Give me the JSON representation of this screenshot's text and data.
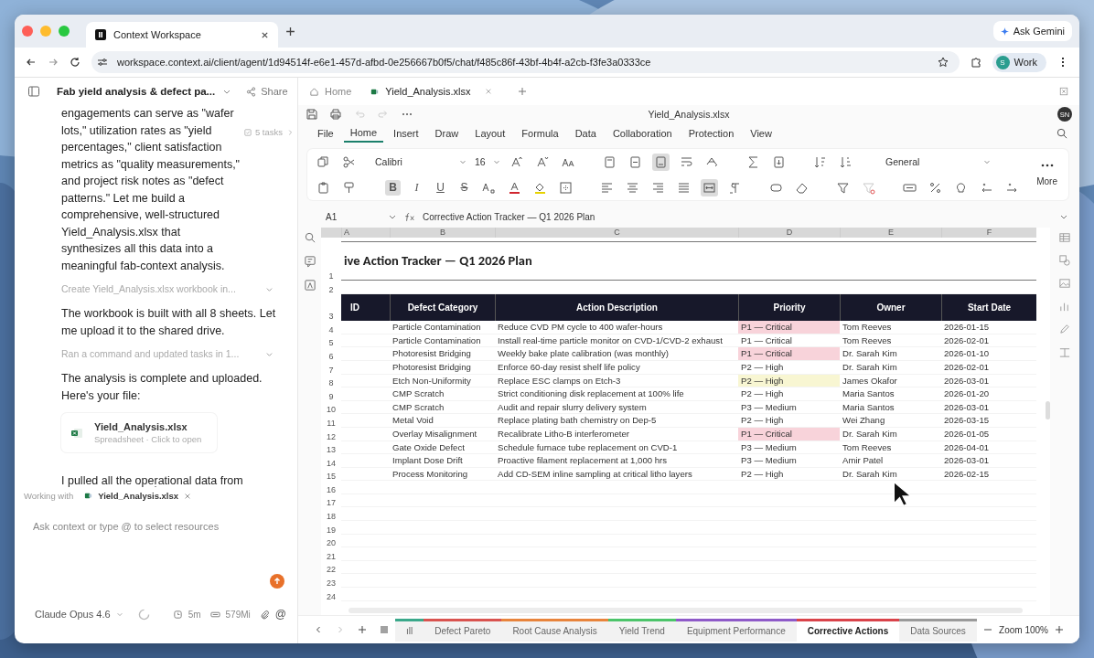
{
  "browser": {
    "tab": {
      "title": "Context Workspace",
      "selected": true
    },
    "ask_button": "Ask Gemini",
    "url": "workspace.context.ai/client/agent/1d94514f-e6e1-457d-afbd-0e256667b0f5/chat/f485c86f-43bf-4b4f-a2cb-f3fe3a0333ce",
    "profile": {
      "initial": "S",
      "label": "Work"
    }
  },
  "chat": {
    "title": "Fab yield analysis & defect pa...",
    "share": "Share",
    "tasks_chip": "5 tasks",
    "messages": [
      {
        "kind": "text",
        "text": "engagements can serve as \"wafer lots,\" utilization rates as \"yield percentages,\" client satisfaction metrics as \"quality measurements,\" and project risk notes as \"defect patterns.\" Let me build a comprehensive, well-structured Yield_Analysis.xlsx that synthesizes all this data into a meaningful fab-context analysis."
      },
      {
        "kind": "step",
        "text": "Create Yield_Analysis.xlsx workbook in..."
      },
      {
        "kind": "text",
        "text": "The workbook is built with all 8 sheets. Let me upload it to the shared drive."
      },
      {
        "kind": "step",
        "text": "Ran a command and updated tasks in 1..."
      },
      {
        "kind": "text",
        "text": "The analysis is complete and uploaded. Here's your file:"
      },
      {
        "kind": "file",
        "name": "Yield_Analysis.xlsx",
        "meta": "Spreadsheet · Click to open"
      },
      {
        "kind": "text",
        "text": "I pulled all the operational data from"
      }
    ],
    "working_with": {
      "label": "Working with",
      "file": "Yield_Analysis.xlsx"
    },
    "input": {
      "placeholder": "Ask context or type @ to select resources"
    },
    "model": "Claude Opus 4.6",
    "time": "5m",
    "memory": "579Mi",
    "mention": "@"
  },
  "workbook": {
    "tabs": [
      {
        "label": "Home",
        "selected": false
      },
      {
        "label": "Yield_Analysis.xlsx",
        "selected": true
      }
    ],
    "title": "Yield_Analysis.xlsx",
    "user_initials": "SN",
    "menu": [
      {
        "label": "File",
        "selected": false
      },
      {
        "label": "Home",
        "selected": true
      },
      {
        "label": "Insert",
        "selected": false
      },
      {
        "label": "Draw",
        "selected": false
      },
      {
        "label": "Layout",
        "selected": false
      },
      {
        "label": "Formula",
        "selected": false
      },
      {
        "label": "Data",
        "selected": false
      },
      {
        "label": "Collaboration",
        "selected": false
      },
      {
        "label": "Protection",
        "selected": false
      },
      {
        "label": "View",
        "selected": false
      }
    ],
    "font": "Calibri",
    "font_size": "16",
    "number_format": "General",
    "more": "More",
    "format_buttons": [
      {
        "label": "B",
        "selected": true
      },
      {
        "label": "I",
        "selected": false
      },
      {
        "label": "U",
        "selected": false
      },
      {
        "label": "S",
        "selected": false
      }
    ],
    "cell_ref": "A1",
    "formula": "Corrective Action Tracker — Q1 2026 Plan",
    "columns": [
      "A",
      "B",
      "C",
      "D",
      "E",
      "F"
    ],
    "sheet_title": "ive Action Tracker — Q1 2026 Plan",
    "header_row": "3",
    "headers": [
      "ID",
      "Defect Category",
      "Action Description",
      "Priority",
      "Owner",
      "Start Date"
    ],
    "rows": [
      {
        "row": "4",
        "category": "Particle Contamination",
        "action": "Reduce CVD PM cycle to 400 wafer-hours",
        "priority": "P1 — Critical",
        "owner": "Tom Reeves",
        "start": "2026-01-15",
        "color": "#f8d3da"
      },
      {
        "row": "5",
        "category": "Particle Contamination",
        "action": "Install real-time particle monitor on CVD-1/CVD-2 exhaust",
        "priority": "P1 — Critical",
        "owner": "Tom Reeves",
        "start": "2026-02-01"
      },
      {
        "row": "6",
        "category": "Photoresist Bridging",
        "action": "Weekly bake plate calibration (was monthly)",
        "priority": "P1 — Critical",
        "owner": "Dr. Sarah Kim",
        "start": "2026-01-10",
        "color": "#f8d3da"
      },
      {
        "row": "7",
        "category": "Photoresist Bridging",
        "action": "Enforce 60-day resist shelf life policy",
        "priority": "P2 — High",
        "owner": "Dr. Sarah Kim",
        "start": "2026-02-01"
      },
      {
        "row": "8",
        "category": "Etch Non-Uniformity",
        "action": "Replace ESC clamps on Etch-3",
        "priority": "P2 — High",
        "owner": "James Okafor",
        "start": "2026-03-01",
        "color": "#f8f6d2"
      },
      {
        "row": "9",
        "category": "CMP Scratch",
        "action": "Strict conditioning disk replacement at 100% life",
        "priority": "P2 — High",
        "owner": "Maria Santos",
        "start": "2026-01-20"
      },
      {
        "row": "10",
        "category": "CMP Scratch",
        "action": "Audit and repair slurry delivery system",
        "priority": "P3 — Medium",
        "owner": "Maria Santos",
        "start": "2026-03-01"
      },
      {
        "row": "11",
        "category": "Metal Void",
        "action": "Replace plating bath chemistry on Dep-5",
        "priority": "P2 — High",
        "owner": "Wei Zhang",
        "start": "2026-03-15"
      },
      {
        "row": "12",
        "category": "Overlay Misalignment",
        "action": "Recalibrate Litho-B interferometer",
        "priority": "P1 — Critical",
        "owner": "Dr. Sarah Kim",
        "start": "2026-01-05",
        "color": "#f8d3da"
      },
      {
        "row": "13",
        "category": "Gate Oxide Defect",
        "action": "Schedule furnace tube replacement on CVD-1",
        "priority": "P3 — Medium",
        "owner": "Tom Reeves",
        "start": "2026-04-01"
      },
      {
        "row": "14",
        "category": "Implant Dose Drift",
        "action": "Proactive filament replacement at 1,000 hrs",
        "priority": "P3 — Medium",
        "owner": "Amir Patel",
        "start": "2026-03-01"
      },
      {
        "row": "15",
        "category": "Process Monitoring",
        "action": "Add CD-SEM inline sampling at critical litho layers",
        "priority": "P2 — High",
        "owner": "Dr. Sarah Kim",
        "start": "2026-02-15"
      }
    ],
    "top_rows": [
      "1",
      "2"
    ],
    "empty_rows": [
      "16",
      "17",
      "18",
      "19",
      "20",
      "21",
      "22",
      "23",
      "24"
    ],
    "sheets": [
      {
        "label": "ıll",
        "color": "#3aa88a",
        "selected": false
      },
      {
        "label": "Defect Pareto",
        "color": "#d9534f",
        "selected": false
      },
      {
        "label": "Root Cause Analysis",
        "color": "#e8843c",
        "selected": false
      },
      {
        "label": "Yield Trend",
        "color": "#4cc46a",
        "selected": false
      },
      {
        "label": "Equipment Performance",
        "color": "#8e5ac8",
        "selected": false
      },
      {
        "label": "Corrective Actions",
        "color": "#d9434a",
        "selected": true
      },
      {
        "label": "Data Sources",
        "color": "#9a9a9a",
        "selected": false
      }
    ],
    "zoom": "Zoom 100%"
  }
}
